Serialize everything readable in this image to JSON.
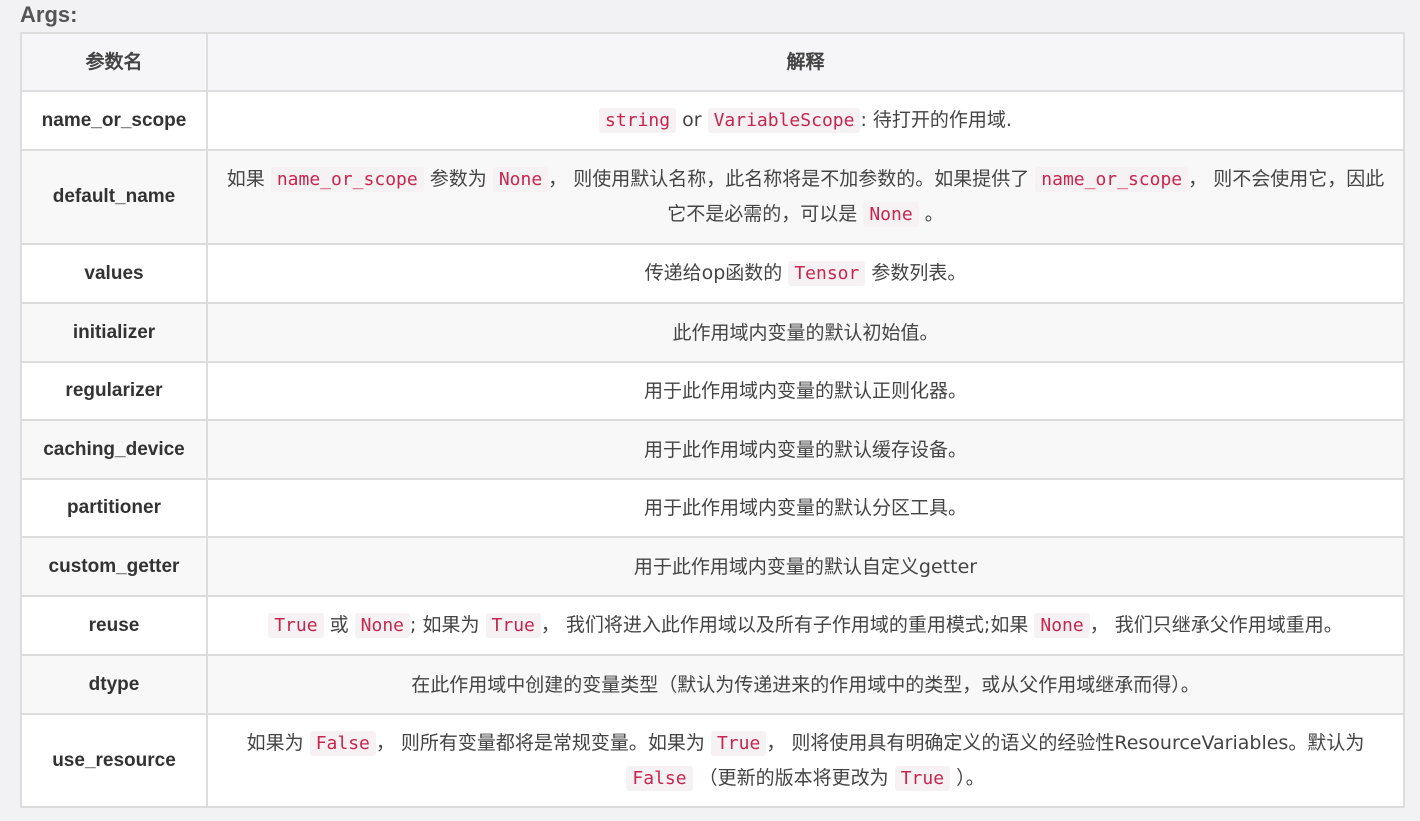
{
  "title": "Args:",
  "header": {
    "param": "参数名",
    "explain": "解释"
  },
  "rows": [
    {
      "name": "name_or_scope",
      "parts": [
        {
          "code": "string"
        },
        {
          "text": " or "
        },
        {
          "code": "VariableScope"
        },
        {
          "text": ": 待打开的作用域."
        }
      ]
    },
    {
      "name": "default_name",
      "parts": [
        {
          "text": "如果 "
        },
        {
          "code": "name_or_scope"
        },
        {
          "text": " 参数为 "
        },
        {
          "code": "None"
        },
        {
          "text": "， 则使用默认名称，此名称将是不加参数的。如果提供了 "
        },
        {
          "code": "name_or_scope"
        },
        {
          "text": "， 则不会使用它，因此它不是必需的，可以是 "
        },
        {
          "code": "None"
        },
        {
          "text": " 。"
        }
      ]
    },
    {
      "name": "values",
      "parts": [
        {
          "text": "传递给op函数的 "
        },
        {
          "code": "Tensor"
        },
        {
          "text": " 参数列表。"
        }
      ]
    },
    {
      "name": "initializer",
      "parts": [
        {
          "text": "此作用域内变量的默认初始值。"
        }
      ]
    },
    {
      "name": "regularizer",
      "parts": [
        {
          "text": "用于此作用域内变量的默认正则化器。"
        }
      ]
    },
    {
      "name": "caching_device",
      "parts": [
        {
          "text": "用于此作用域内变量的默认缓存设备。"
        }
      ]
    },
    {
      "name": "partitioner",
      "parts": [
        {
          "text": "用于此作用域内变量的默认分区工具。"
        }
      ]
    },
    {
      "name": "custom_getter",
      "parts": [
        {
          "text": "用于此作用域内变量的默认自定义getter"
        }
      ]
    },
    {
      "name": "reuse",
      "parts": [
        {
          "code": "True"
        },
        {
          "text": " 或 "
        },
        {
          "code": "None"
        },
        {
          "text": "; 如果为 "
        },
        {
          "code": "True"
        },
        {
          "text": "， 我们将进入此作用域以及所有子作用域的重用模式;如果 "
        },
        {
          "code": "None"
        },
        {
          "text": "， 我们只继承父作用域重用。"
        }
      ]
    },
    {
      "name": "dtype",
      "parts": [
        {
          "text": "在此作用域中创建的变量类型（默认为传递进来的作用域中的类型，或从父作用域继承而得）。"
        }
      ]
    },
    {
      "name": "use_resource",
      "parts": [
        {
          "text": "如果为 "
        },
        {
          "code": "False"
        },
        {
          "text": "， 则所有变量都将是常规变量。如果为 "
        },
        {
          "code": "True"
        },
        {
          "text": "， 则将使用具有明确定义的语义的经验性ResourceVariables。默认为 "
        },
        {
          "code": "False"
        },
        {
          "text": " （更新的版本将更改为 "
        },
        {
          "code": "True"
        },
        {
          "text": " ）。"
        }
      ]
    }
  ]
}
